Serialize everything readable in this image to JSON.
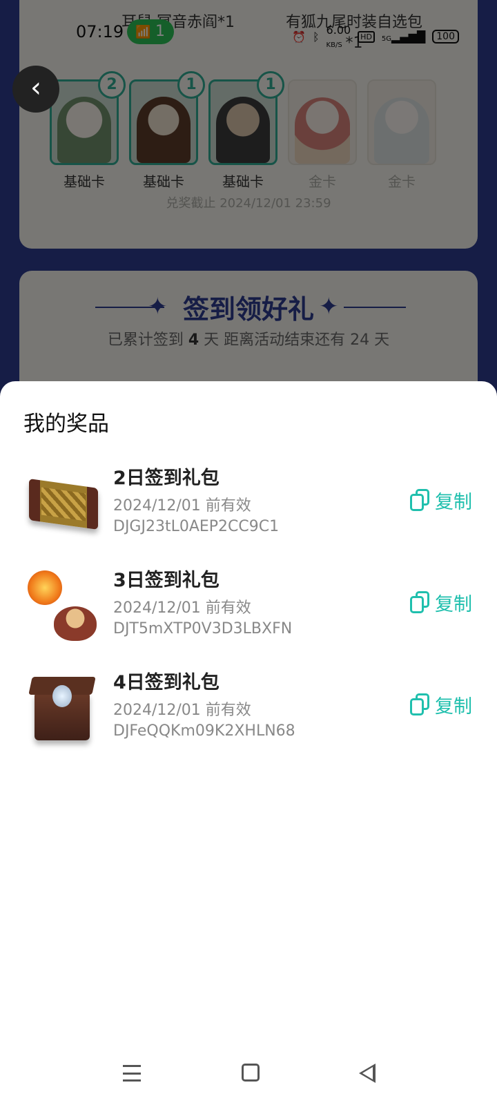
{
  "status_bar": {
    "time": "07:19",
    "hotspot_count": "1",
    "net_speed": "6.00",
    "net_speed_unit": "KB/S",
    "hd_label": "HD",
    "signal_label": "5G",
    "battery": "100"
  },
  "background": {
    "top_left_text": "耳鼠·冥音赤阎*1",
    "top_right_text": "有狐九尾时装自选包*1",
    "cards": [
      {
        "label": "基础卡",
        "badge": "2",
        "type": "basic"
      },
      {
        "label": "基础卡",
        "badge": "1",
        "type": "basic"
      },
      {
        "label": "基础卡",
        "badge": "1",
        "type": "basic"
      },
      {
        "label": "金卡",
        "badge": "",
        "type": "gold"
      },
      {
        "label": "金卡",
        "badge": "",
        "type": "gold"
      }
    ],
    "deadline": "兑奖截止 2024/12/01 23:59",
    "checkin_title": "签到领好礼",
    "checkin_sub_prefix": "已累计签到 ",
    "checkin_days": "4",
    "checkin_sub_suffix": " 天  距离活动结束还有 24 天"
  },
  "sheet": {
    "title": "我的奖品",
    "copy_label": "复制",
    "prizes": [
      {
        "name": "2日签到礼包",
        "date": "2024/12/01 前有效",
        "code": "DJGJ23tL0AEP2CC9C1"
      },
      {
        "name": "3日签到礼包",
        "date": "2024/12/01 前有效",
        "code": "DJT5mXTP0V3D3LBXFN"
      },
      {
        "name": "4日签到礼包",
        "date": "2024/12/01 前有效",
        "code": "DJFeQQKm09K2XHLN68"
      }
    ]
  }
}
